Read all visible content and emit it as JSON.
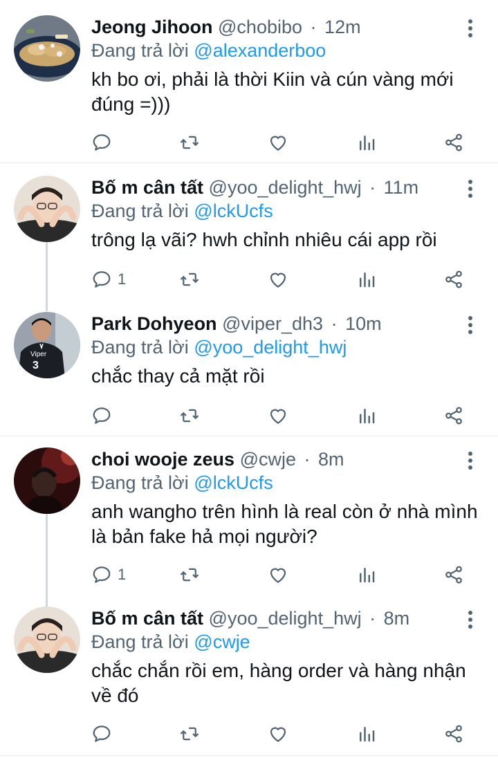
{
  "tweets": [
    {
      "name": "Jeong Jihoon",
      "handle": "@chobibo",
      "separator": "·",
      "time": "12m",
      "reply_prefix": "Đang trả lời",
      "reply_to": "@alexanderboo",
      "text": "kh bo ơi, phải là thời Kiin và cún vàng mới đúng =)))",
      "reply_count": ""
    },
    {
      "name": "Bố m cân tất",
      "handle": "@yoo_delight_hwj",
      "separator": "·",
      "time": "11m",
      "reply_prefix": "Đang trả lời",
      "reply_to": "@lckUcfs",
      "text": "trông lạ vãi? hwh chỉnh nhiêu cái app rồi",
      "reply_count": "1"
    },
    {
      "name": "Park Dohyeon",
      "handle": "@viper_dh3",
      "separator": "·",
      "time": "10m",
      "reply_prefix": "Đang trả lời",
      "reply_to": "@yoo_delight_hwj",
      "text": "chắc thay cả mặt rồi",
      "reply_count": "",
      "avatar_jersey_text": "Viper",
      "avatar_jersey_number": "3"
    },
    {
      "name": "choi wooje zeus",
      "handle": "@cwje",
      "separator": "·",
      "time": "8m",
      "reply_prefix": "Đang trả lời",
      "reply_to": "@lckUcfs",
      "text": "anh wangho trên hình là real còn ở nhà mình là bản fake hả mọi người?",
      "reply_count": "1"
    },
    {
      "name": "Bố m cân tất",
      "handle": "@yoo_delight_hwj",
      "separator": "·",
      "time": "8m",
      "reply_prefix": "Đang trả lời",
      "reply_to": "@cwje",
      "text": "chắc chắn rồi em, hàng order và hàng nhận về đó",
      "reply_count": ""
    }
  ],
  "icons": {
    "reply": "reply-icon",
    "retweet": "retweet-icon",
    "like": "heart-icon",
    "stats": "stats-icon",
    "share": "share-icon",
    "more": "more-vertical-icon"
  },
  "colors": {
    "link": "#1d9bf0",
    "muted": "#536471",
    "text": "#0f1419",
    "thread_line": "#cfd9de",
    "divider": "#e6ecf0"
  }
}
